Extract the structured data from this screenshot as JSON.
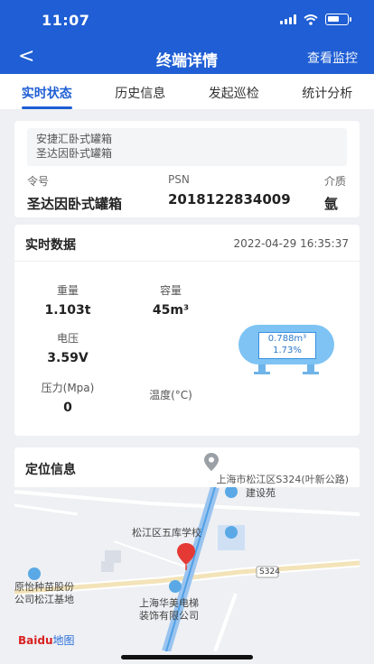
{
  "status_bar": {
    "time": "11:07"
  },
  "nav": {
    "back_label": "<",
    "title": "终端详情",
    "monitor_label": "查看监控"
  },
  "tabs": [
    {
      "label": "实时状态",
      "active": true
    },
    {
      "label": "历史信息",
      "active": false
    },
    {
      "label": "发起巡检",
      "active": false
    },
    {
      "label": "统计分析",
      "active": false
    }
  ],
  "device": {
    "names": [
      "安捷汇卧式罐箱",
      "圣达因卧式罐箱"
    ],
    "fields": [
      {
        "label": "令号",
        "value": "圣达因卧式罐箱"
      },
      {
        "label": "PSN",
        "value": "2018122834009"
      },
      {
        "label": "介质",
        "value": "氩"
      }
    ]
  },
  "realtime": {
    "title": "实时数据",
    "timestamp": "2022-04-29 16:35:37",
    "metrics": {
      "weight": {
        "label": "重量",
        "value": "1.103t"
      },
      "capacity": {
        "label": "容量",
        "value": "45m³"
      },
      "voltage": {
        "label": "电压",
        "value": "3.59V"
      },
      "pressure": {
        "label": "压力(Mpa)",
        "value": "0"
      },
      "temperature": {
        "label": "温度(°C)",
        "value": ""
      }
    },
    "tank": {
      "volume": "0.788m³",
      "percent": "1.73%"
    }
  },
  "location": {
    "title": "定位信息",
    "address": "上海市松江区S324(叶新公路)",
    "map_labels": {
      "construction": "建设苑",
      "school": "松江区五库学校",
      "road": "S324",
      "left_company_1": "原怡种苗股份",
      "left_company_2": "公司松江基地",
      "elevator_1": "上海华美电梯",
      "elevator_2": "装饰有限公司"
    },
    "baidu_logo": "Baidu",
    "baidu_map_text": "地图"
  },
  "colors": {
    "primary": "#1f5ed4",
    "tank": "#7ec3f3",
    "pin": "#e53935"
  }
}
